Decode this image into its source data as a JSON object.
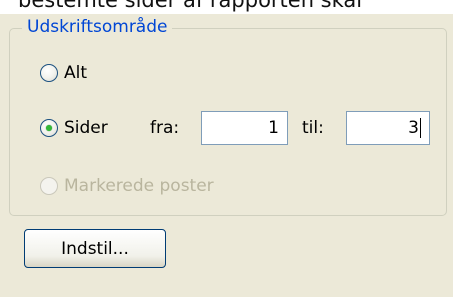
{
  "header": {
    "partial_text": "bestemte sider af rapporten skal"
  },
  "print_range": {
    "legend": "Udskriftsområde",
    "options": {
      "all": {
        "label": "Alt",
        "checked": false,
        "enabled": true
      },
      "pages": {
        "label": "Sider",
        "checked": true,
        "enabled": true
      },
      "selected_records": {
        "label": "Markerede poster",
        "checked": false,
        "enabled": false
      }
    },
    "from_label": "fra:",
    "from_value": "1",
    "to_label": "til:",
    "to_value": "3"
  },
  "buttons": {
    "setup_label": "Indstil..."
  },
  "colors": {
    "legend": "#0046d5",
    "dialog_background": "#ece9d8",
    "radio_checked": "#34b838",
    "disabled_text": "#b9b59e"
  }
}
